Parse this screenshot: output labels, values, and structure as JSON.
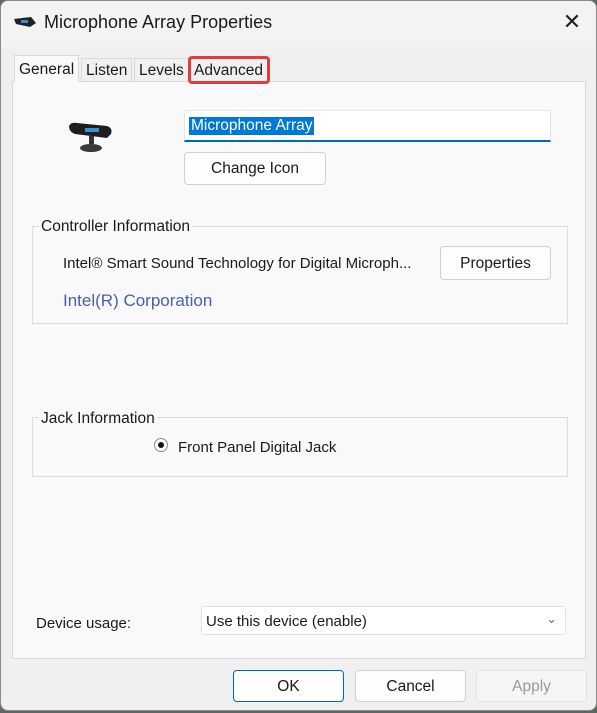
{
  "window": {
    "title": "Microphone Array Properties",
    "close_icon": "close-icon"
  },
  "tabs": [
    {
      "label": "General",
      "active": true
    },
    {
      "label": "Listen"
    },
    {
      "label": "Levels"
    },
    {
      "label": "Advanced",
      "highlighted": true
    }
  ],
  "general": {
    "device_name": "Microphone Array",
    "change_icon_label": "Change Icon",
    "controller": {
      "title": "Controller Information",
      "name": "Intel® Smart Sound Technology for Digital Microph...",
      "manufacturer": "Intel(R) Corporation",
      "properties_label": "Properties"
    },
    "jack": {
      "title": "Jack Information",
      "name": "Front Panel Digital Jack"
    },
    "device_usage": {
      "label": "Device usage:",
      "value": "Use this device (enable)"
    }
  },
  "footer": {
    "ok": "OK",
    "cancel": "Cancel",
    "apply": "Apply"
  },
  "colors": {
    "accent": "#0067c0",
    "highlight": "#e53a40",
    "link": "#4a5fa8"
  }
}
